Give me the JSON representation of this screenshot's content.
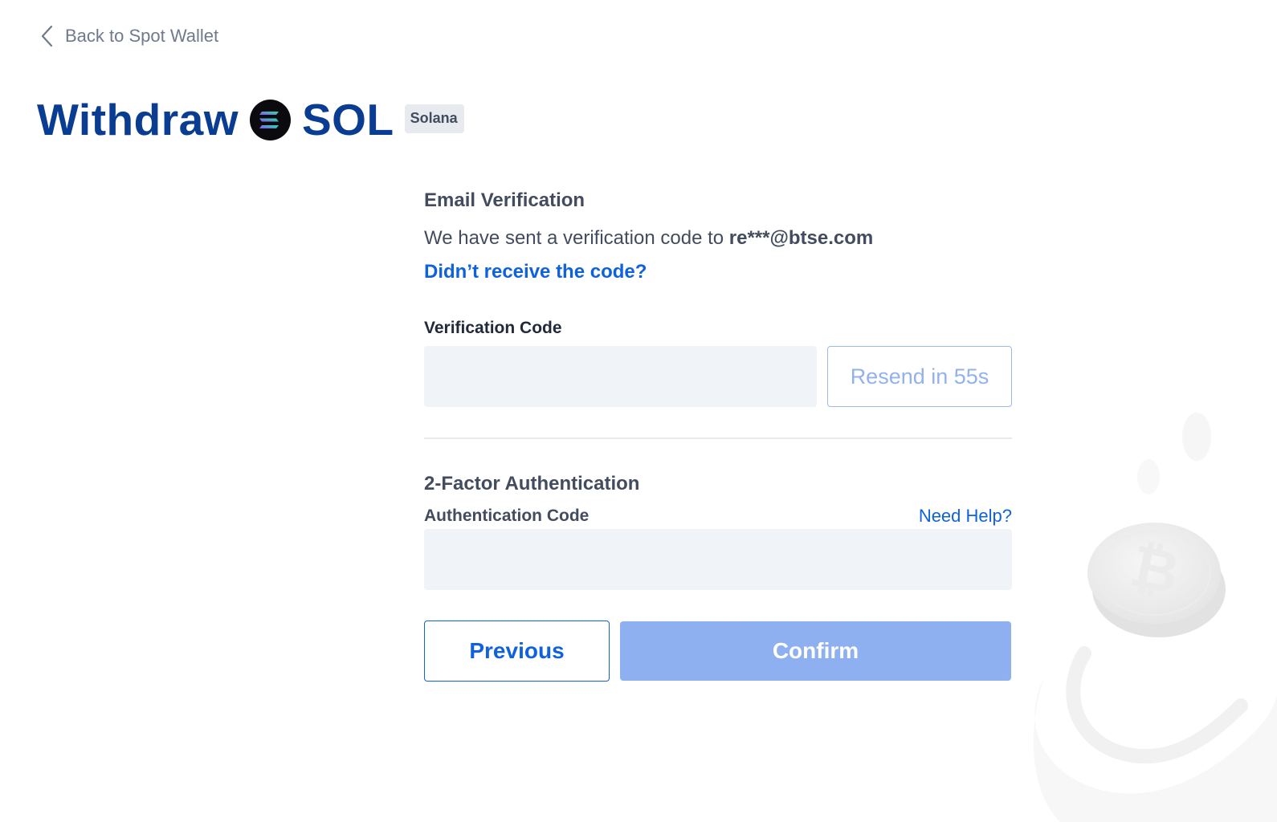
{
  "nav": {
    "back_label": "Back to Spot Wallet"
  },
  "header": {
    "title_prefix": "Withdraw",
    "coin_symbol": "SOL",
    "network_badge": "Solana"
  },
  "email_verification": {
    "title": "Email Verification",
    "sent_text": "We have sent a verification code to",
    "email": "re***@btse.com",
    "resend_link": "Didn’t receive the code?",
    "field_label": "Verification Code",
    "field_value": "",
    "resend_button": "Resend in 55s"
  },
  "two_factor": {
    "title": "2-Factor Authentication",
    "field_label": "Authentication Code",
    "help_link": "Need Help?",
    "field_value": ""
  },
  "actions": {
    "previous": "Previous",
    "confirm": "Confirm"
  },
  "colors": {
    "brand_navy": "#0a3d91",
    "link_blue": "#0f62dc",
    "confirm_disabled": "#8fb0f0",
    "input_bg": "#f0f3f7"
  },
  "icons": {
    "back": "chevron-left-icon",
    "coin": "solana-logo-icon",
    "background": "bitcoin-coin-icon"
  }
}
